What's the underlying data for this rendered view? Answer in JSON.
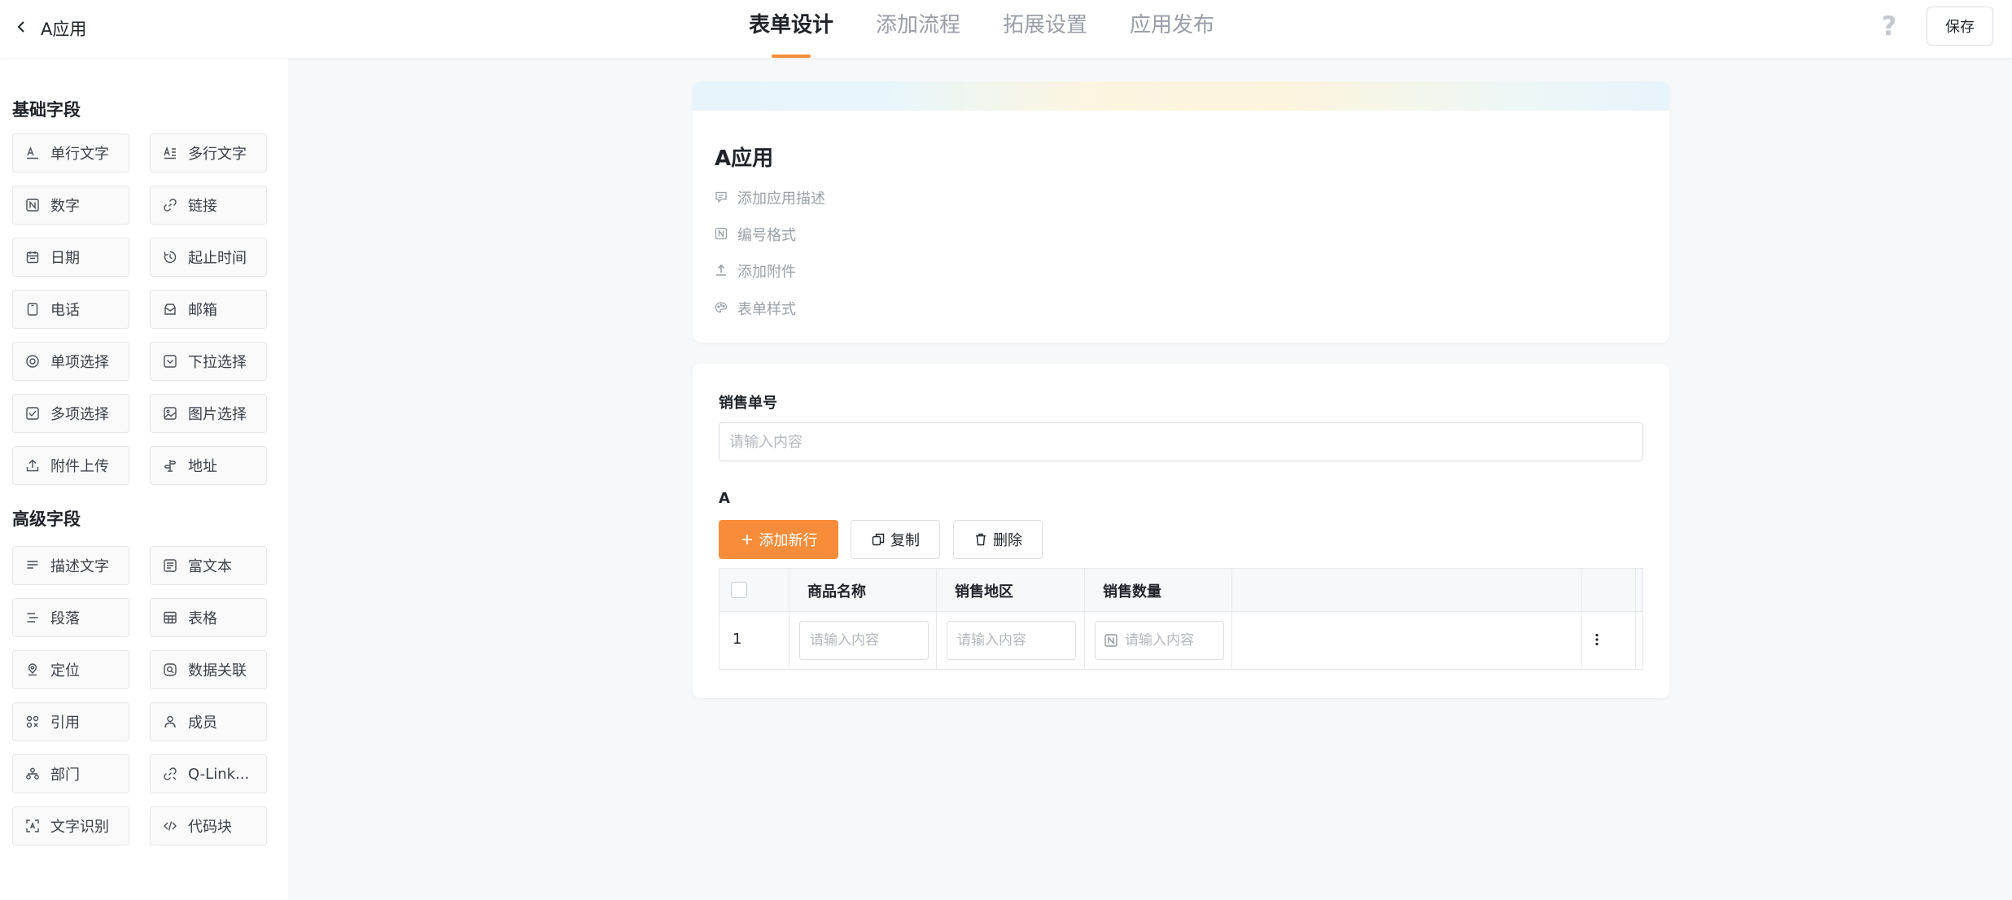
{
  "header": {
    "back_title": "A应用",
    "tabs": [
      {
        "label": "表单设计",
        "active": true
      },
      {
        "label": "添加流程",
        "active": false
      },
      {
        "label": "拓展设置",
        "active": false
      },
      {
        "label": "应用发布",
        "active": false
      }
    ],
    "help_glyph": "?",
    "save_label": "保存"
  },
  "sidebar": {
    "basic_title": "基础字段",
    "advanced_title": "高级字段",
    "basic_fields": [
      {
        "label": "单行文字",
        "icon": "text-line-icon"
      },
      {
        "label": "多行文字",
        "icon": "text-multiline-icon"
      },
      {
        "label": "数字",
        "icon": "number-icon"
      },
      {
        "label": "链接",
        "icon": "link-icon"
      },
      {
        "label": "日期",
        "icon": "calendar-icon"
      },
      {
        "label": "起止时间",
        "icon": "time-range-icon"
      },
      {
        "label": "电话",
        "icon": "phone-icon"
      },
      {
        "label": "邮箱",
        "icon": "mail-icon"
      },
      {
        "label": "单项选择",
        "icon": "radio-icon"
      },
      {
        "label": "下拉选择",
        "icon": "dropdown-icon"
      },
      {
        "label": "多项选择",
        "icon": "checkbox-icon"
      },
      {
        "label": "图片选择",
        "icon": "image-icon"
      },
      {
        "label": "附件上传",
        "icon": "upload-icon"
      },
      {
        "label": "地址",
        "icon": "address-icon"
      }
    ],
    "advanced_fields": [
      {
        "label": "描述文字",
        "icon": "description-icon"
      },
      {
        "label": "富文本",
        "icon": "rich-text-icon"
      },
      {
        "label": "段落",
        "icon": "paragraph-icon"
      },
      {
        "label": "表格",
        "icon": "table-icon"
      },
      {
        "label": "定位",
        "icon": "location-icon"
      },
      {
        "label": "数据关联",
        "icon": "data-link-icon"
      },
      {
        "label": "引用",
        "icon": "reference-icon"
      },
      {
        "label": "成员",
        "icon": "member-icon"
      },
      {
        "label": "部门",
        "icon": "department-icon"
      },
      {
        "label": "Q-Link...",
        "icon": "q-link-icon"
      },
      {
        "label": "文字识别",
        "icon": "ocr-icon"
      },
      {
        "label": "代码块",
        "icon": "code-icon"
      }
    ]
  },
  "form_header": {
    "title": "A应用",
    "items": [
      {
        "label": "添加应用描述",
        "icon": "comment-icon"
      },
      {
        "label": "编号格式",
        "icon": "number-format-icon"
      },
      {
        "label": "添加附件",
        "icon": "attachment-upload-icon"
      },
      {
        "label": "表单样式",
        "icon": "palette-icon"
      }
    ]
  },
  "form": {
    "sales_no_label": "销售单号",
    "sales_no_placeholder": "请输入内容",
    "subtable_label": "A",
    "add_row_label": "添加新行",
    "copy_label": "复制",
    "delete_label": "删除",
    "columns": [
      "商品名称",
      "销售地区",
      "销售数量"
    ],
    "rows": [
      {
        "index": "1",
        "placeholder": "请输入内容"
      }
    ]
  },
  "colors": {
    "accent": "#f78d3a",
    "text": "#1f2329",
    "muted": "#999ea8"
  }
}
